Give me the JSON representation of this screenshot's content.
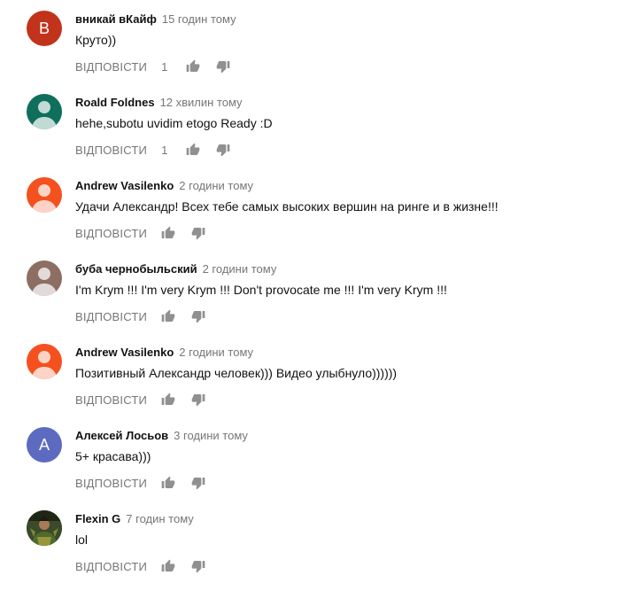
{
  "comments": [
    {
      "author": "вникай вКайф",
      "time": "15 годин тому",
      "text": "Круто))",
      "reply_label": "ВІДПОВІСТИ",
      "likes": "1",
      "avatar_letter": "В",
      "avatar_color": "#c1331b"
    },
    {
      "author": "Roald Foldnes",
      "time": "12 хвилин тому",
      "text": "hehe,subotu uvidim etogo Ready :D",
      "reply_label": "ВІДПОВІСТИ",
      "likes": "1",
      "avatar_color": "#0f6e5c"
    },
    {
      "author": "Andrew Vasilenko",
      "time": "2 години тому",
      "text": "Удачи Александр!  Всех тебе самых высоких вершин на ринге и в жизне!!!",
      "reply_label": "ВІДПОВІСТИ",
      "avatar_color": "#f4511e"
    },
    {
      "author": "буба чернобыльский",
      "time": "2 години тому",
      "text": "I'm Krym !!! I'm very Krym !!! Don't provocate me !!! I'm very Krym !!!",
      "reply_label": "ВІДПОВІСТИ",
      "avatar_color": "#8d6e63"
    },
    {
      "author": "Andrew Vasilenko",
      "time": "2 години тому",
      "text": "Позитивный Александр человек))) Видео улыбнуло))))))",
      "reply_label": "ВІДПОВІСТИ",
      "avatar_color": "#f4511e"
    },
    {
      "author": "Алексей Лосьов",
      "time": "3 години тому",
      "text": "5+ красава)))",
      "reply_label": "ВІДПОВІСТИ",
      "avatar_letter": "А",
      "avatar_color": "#5c6bc0"
    },
    {
      "author": "Flexin G",
      "time": "7 годин тому",
      "text": "lol",
      "reply_label": "ВІДПОВІСТИ",
      "avatar_color": "#2e3b1f"
    }
  ],
  "icons": {
    "like": "thumbs-up-icon",
    "dislike": "thumbs-down-icon",
    "avatar_default": "person-silhouette-icon",
    "avatar_photo": "user-photo"
  }
}
